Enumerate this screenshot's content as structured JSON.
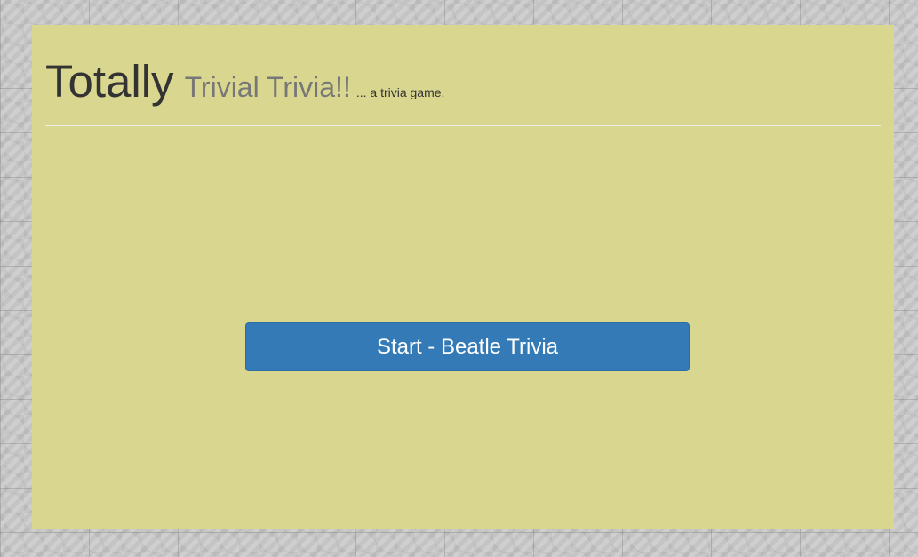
{
  "header": {
    "title_main": "Totally",
    "title_sub": "Trivial Trivia!!",
    "tagline": "... a trivia game."
  },
  "main": {
    "start_button_label": "Start - Beatle Trivia"
  },
  "colors": {
    "panel_background": "#d9d78f",
    "button_primary": "#337ab7",
    "title_main": "#333333",
    "title_sub": "#777777"
  }
}
